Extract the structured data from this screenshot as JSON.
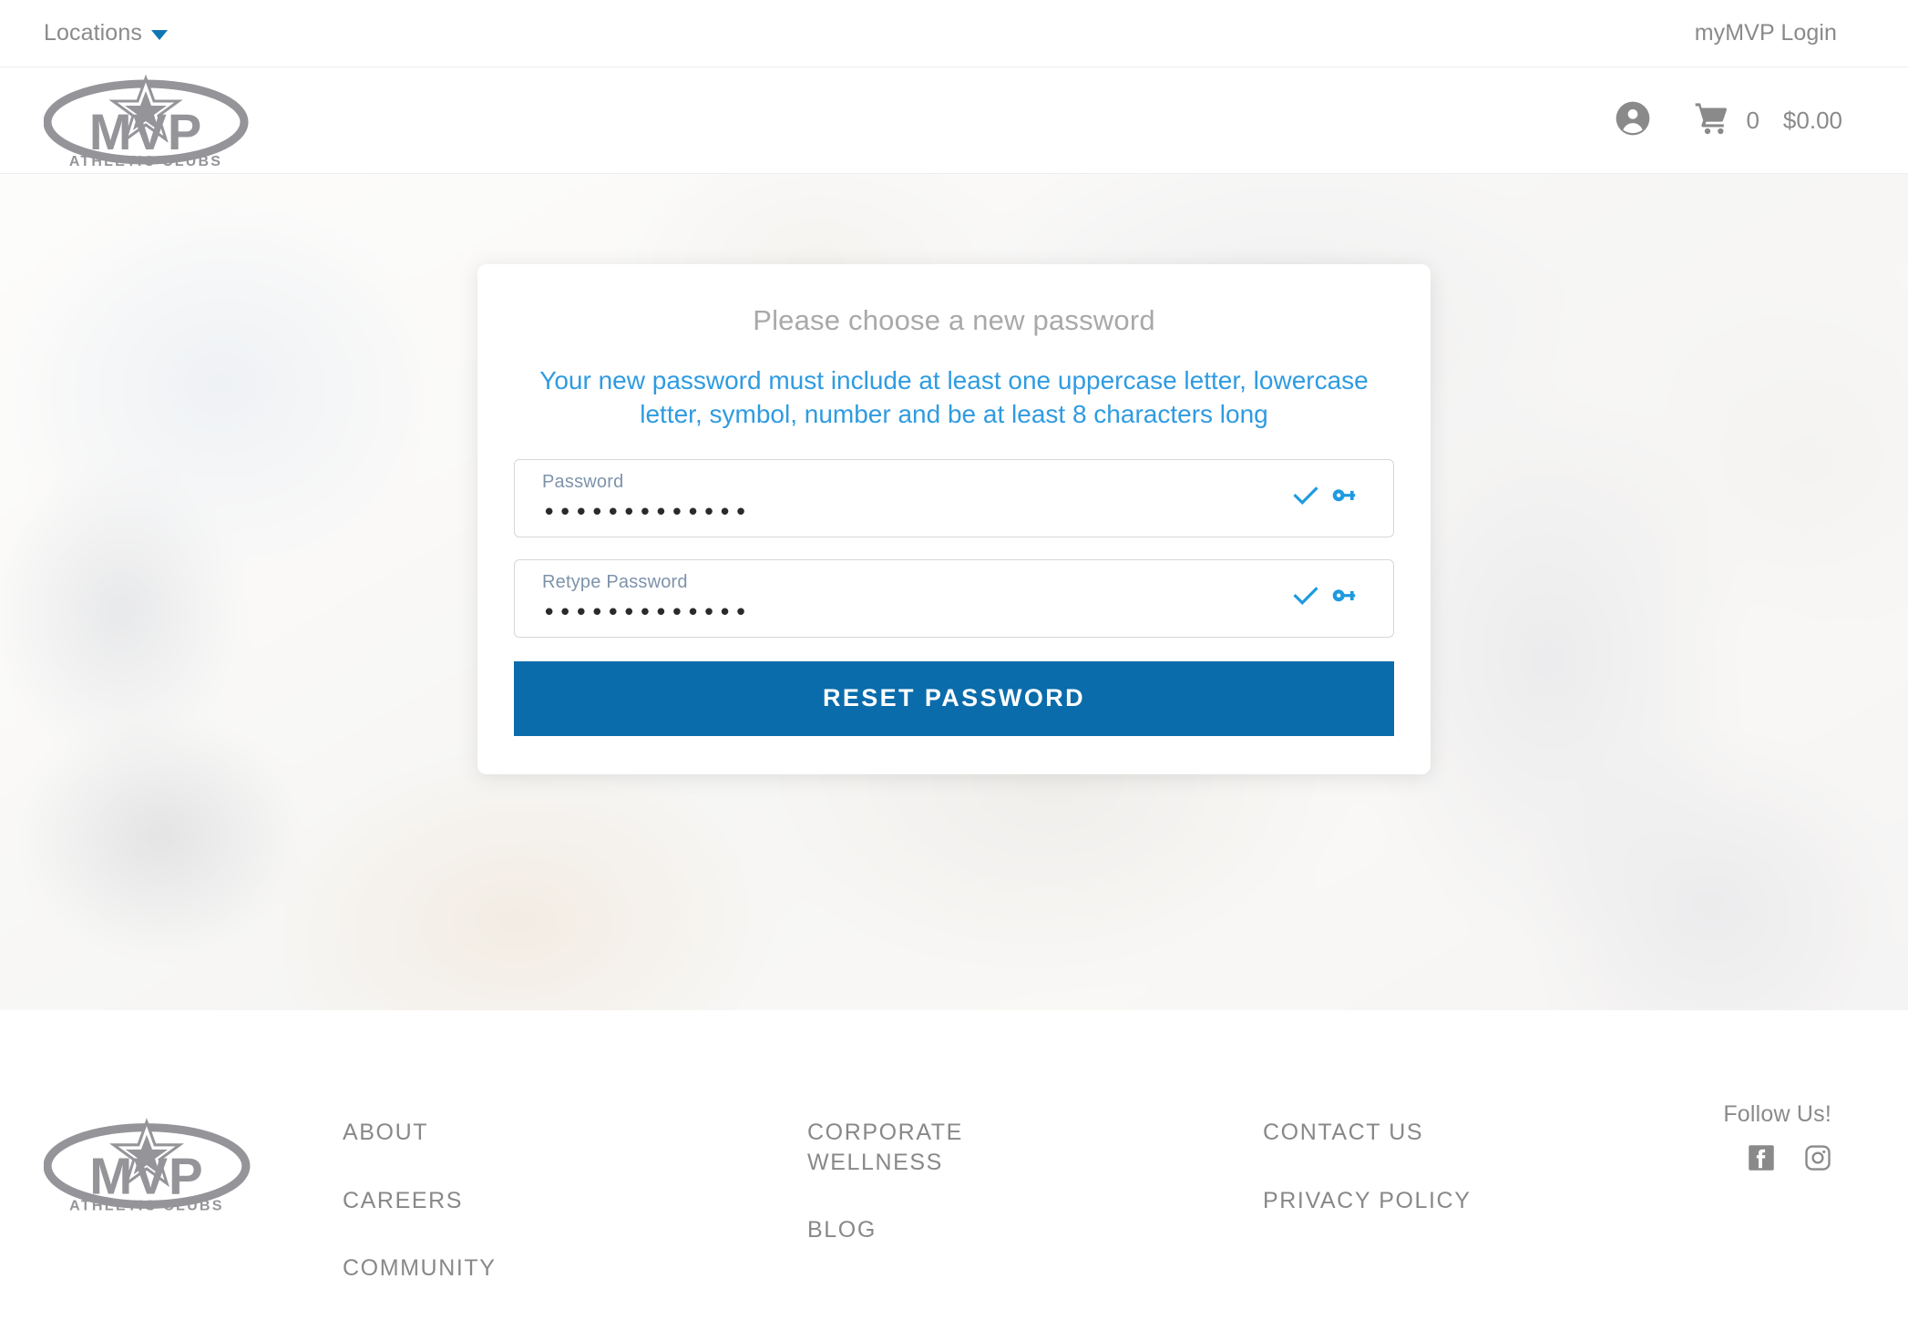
{
  "utility_bar": {
    "locations_label": "Locations",
    "login_label": "myMVP Login"
  },
  "header": {
    "logo_text": "MVP",
    "logo_tagline": "ATHLETIC CLUBS",
    "cart_count": "0",
    "cart_total": "$0.00"
  },
  "card": {
    "title": "Please choose a new password",
    "subtitle": "Your new password must include at least one uppercase letter, lowercase letter, symbol, number and be at least 8 characters long",
    "password_field": {
      "label": "Password",
      "value": "•••••••••••••",
      "placeholder": "Password"
    },
    "retype_field": {
      "label": "Retype Password",
      "value": "•••••••••••••",
      "placeholder": "Retype Password"
    },
    "submit_label": "RESET PASSWORD"
  },
  "footer": {
    "logo_text": "MVP",
    "logo_tagline": "ATHLETIC CLUBS",
    "columns": [
      {
        "links": [
          "ABOUT",
          "CAREERS",
          "COMMUNITY"
        ]
      },
      {
        "links": [
          "CORPORATE WELLNESS",
          "BLOG"
        ]
      },
      {
        "links": [
          "CONTACT US",
          "PRIVACY POLICY"
        ]
      }
    ],
    "follow_title": "Follow Us!"
  },
  "colors": {
    "accent_blue": "#0a6cab",
    "link_blue": "#2f9be0",
    "icon_blue": "#1e9ae0",
    "logo_gray": "#949499",
    "text_gray": "#8a8a8a"
  }
}
